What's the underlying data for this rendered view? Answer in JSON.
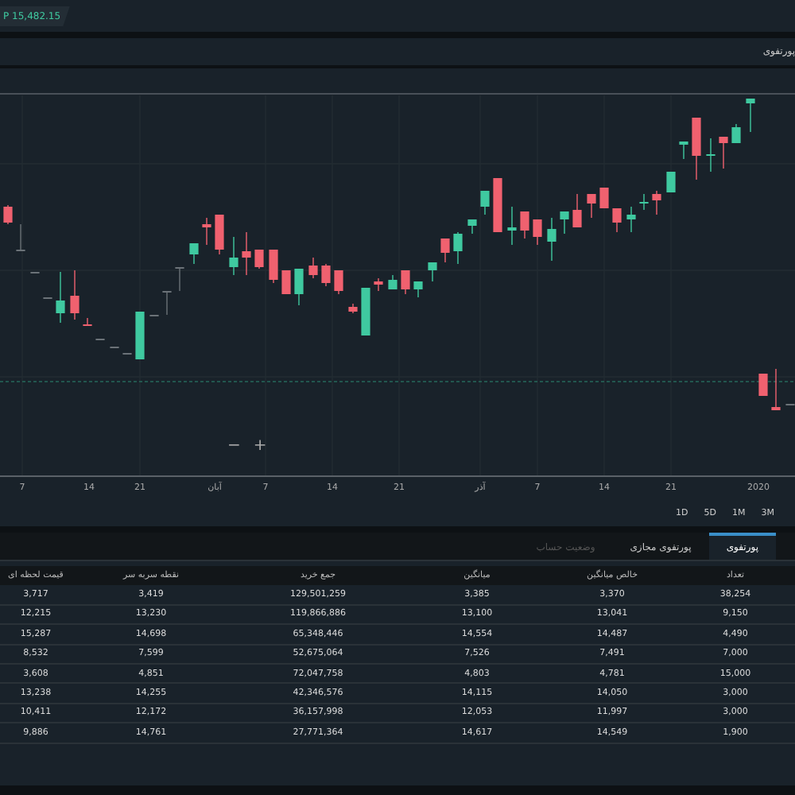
{
  "top_bar": {
    "balance_badge": "P 15,482.15"
  },
  "header": {
    "title": "پورتفوی"
  },
  "chart": {
    "x_axis_labels": [
      "7",
      "14",
      "21",
      "آبان",
      "7",
      "14",
      "21",
      "آذر",
      "7",
      "14",
      "21",
      "2020"
    ],
    "zoom_controls": [
      "−",
      "+"
    ]
  },
  "periods": [
    {
      "label": "1D",
      "selected": false
    },
    {
      "label": "5D",
      "selected": false
    },
    {
      "label": "1M",
      "selected": false
    },
    {
      "label": "3M",
      "selected": false
    }
  ],
  "tabs": [
    {
      "label": "پورتفوی",
      "selected": true,
      "disabled": false
    },
    {
      "label": "پورتفوی مجازی",
      "selected": false,
      "disabled": false
    },
    {
      "label": "وضعیت حساب",
      "selected": false,
      "disabled": true
    }
  ],
  "table": {
    "columns": [
      "قیمت لحظه ای",
      "نقطه سربه سر",
      "جمع خرید",
      "میانگین",
      "خالص میانگین",
      "تعداد"
    ],
    "rows": [
      [
        "3,717",
        "3,419",
        "129,501,259",
        "3,385",
        "3,370",
        "38,254"
      ],
      [
        "12,215",
        "13,230",
        "119,866,886",
        "13,100",
        "13,041",
        "9,150"
      ],
      [
        "15,287",
        "14,698",
        "65,348,446",
        "14,554",
        "14,487",
        "4,490"
      ],
      [
        "8,532",
        "7,599",
        "52,675,064",
        "7,526",
        "7,491",
        "7,000"
      ],
      [
        "3,608",
        "4,851",
        "72,047,758",
        "4,803",
        "4,781",
        "15,000"
      ],
      [
        "13,238",
        "14,255",
        "42,346,576",
        "14,115",
        "14,050",
        "3,000"
      ],
      [
        "10,411",
        "12,172",
        "36,157,998",
        "12,053",
        "11,997",
        "3,000"
      ],
      [
        "9,886",
        "14,761",
        "27,771,364",
        "14,617",
        "14,549",
        "1,900"
      ]
    ]
  }
}
